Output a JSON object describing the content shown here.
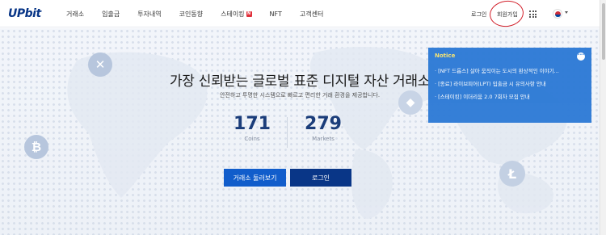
{
  "header": {
    "logo": "UPbit",
    "nav": [
      {
        "label": "거래소"
      },
      {
        "label": "입출금"
      },
      {
        "label": "투자내역"
      },
      {
        "label": "코인동향"
      },
      {
        "label": "스테이킹",
        "badge": "N"
      },
      {
        "label": "NFT"
      },
      {
        "label": "고객센터"
      }
    ],
    "login": "로그인",
    "signup": "회원가입",
    "icons": {
      "apps": "grid-icon",
      "language": "korea-flag-icon",
      "dropdown": "chevron-down-icon"
    }
  },
  "hero": {
    "title": "가장 신뢰받는 글로벌 표준 디지털 자산 거래소",
    "subtitle": "안전하고 투명한 시스템으로 빠르고 편리한 거래 환경을 제공합니다.",
    "stats": [
      {
        "value": "171",
        "label": "Coins"
      },
      {
        "value": "279",
        "label": "Markets"
      }
    ],
    "buttons": {
      "explore": "거래소 둘러보기",
      "login": "로그인"
    }
  },
  "notice": {
    "title": "Notice",
    "more": "···",
    "items": [
      "· [NFT 드롭스] 살아 움직이는 도시의 환상적인 이야기...",
      "· [종료] 라이브피어(LPT) 입출금 시 유의사항 안내",
      "· [스테이킹] 이더리움 2.0 7회차 모집 안내"
    ]
  },
  "colors": {
    "brand": "#093687",
    "accent": "#115dcb",
    "notice": "#2e7bd6",
    "annotation": "#d21f2a"
  }
}
